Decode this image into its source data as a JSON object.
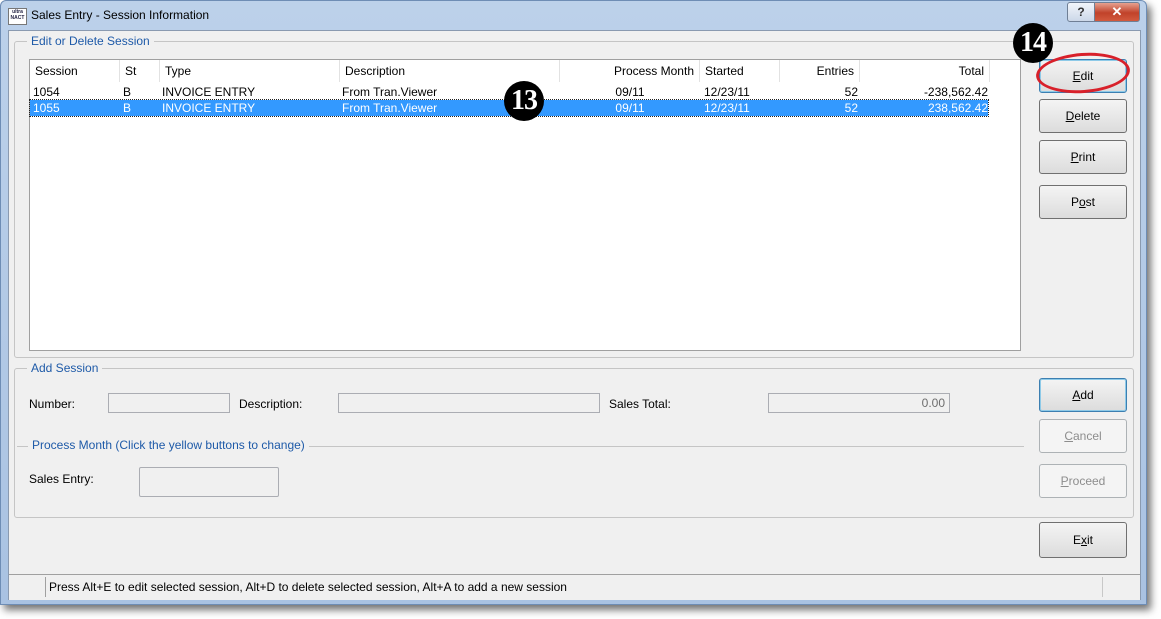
{
  "window": {
    "icon_text": "ultra NACT",
    "title": "Sales Entry - Session Information",
    "help_symbol": "?",
    "close_symbol": "✕"
  },
  "edit_group": {
    "legend": "Edit or Delete Session",
    "columns": {
      "session": "Session",
      "st": "St",
      "type": "Type",
      "description": "Description",
      "process_month": "Process Month",
      "started": "Started",
      "entries": "Entries",
      "total": "Total"
    },
    "rows": [
      {
        "session": "1054",
        "st": "B",
        "type": "INVOICE ENTRY",
        "description": "From Tran.Viewer",
        "process_month": "09/11",
        "started": "12/23/11",
        "entries": "52",
        "total": "-238,562.42"
      },
      {
        "session": "1055",
        "st": "B",
        "type": "INVOICE ENTRY",
        "description": "From Tran.Viewer",
        "process_month": "09/11",
        "started": "12/23/11",
        "entries": "52",
        "total": "238,562.42"
      }
    ]
  },
  "buttons": {
    "edit": "Edit",
    "delete": "Delete",
    "print": "Print",
    "post": "Post",
    "add": "Add",
    "cancel": "Cancel",
    "proceed": "Proceed",
    "exit": "Exit"
  },
  "add_group": {
    "legend": "Add Session",
    "number_label": "Number:",
    "number_value": "",
    "description_label": "Description:",
    "description_value": "",
    "sales_total_label": "Sales Total:",
    "sales_total_value": "0.00"
  },
  "process_month_group": {
    "legend": "Process Month (Click the yellow buttons to change)",
    "sales_entry_label": "Sales Entry:",
    "sales_entry_value": ""
  },
  "status_bar": {
    "text": "Press Alt+E to edit selected session, Alt+D to delete selected session, Alt+A to add a new session"
  },
  "callouts": {
    "step_13": "13",
    "step_14": "14"
  },
  "colors": {
    "selection": "#3399ff",
    "legend_text": "#1e5aa8",
    "annotation_ring": "#d8202a"
  }
}
